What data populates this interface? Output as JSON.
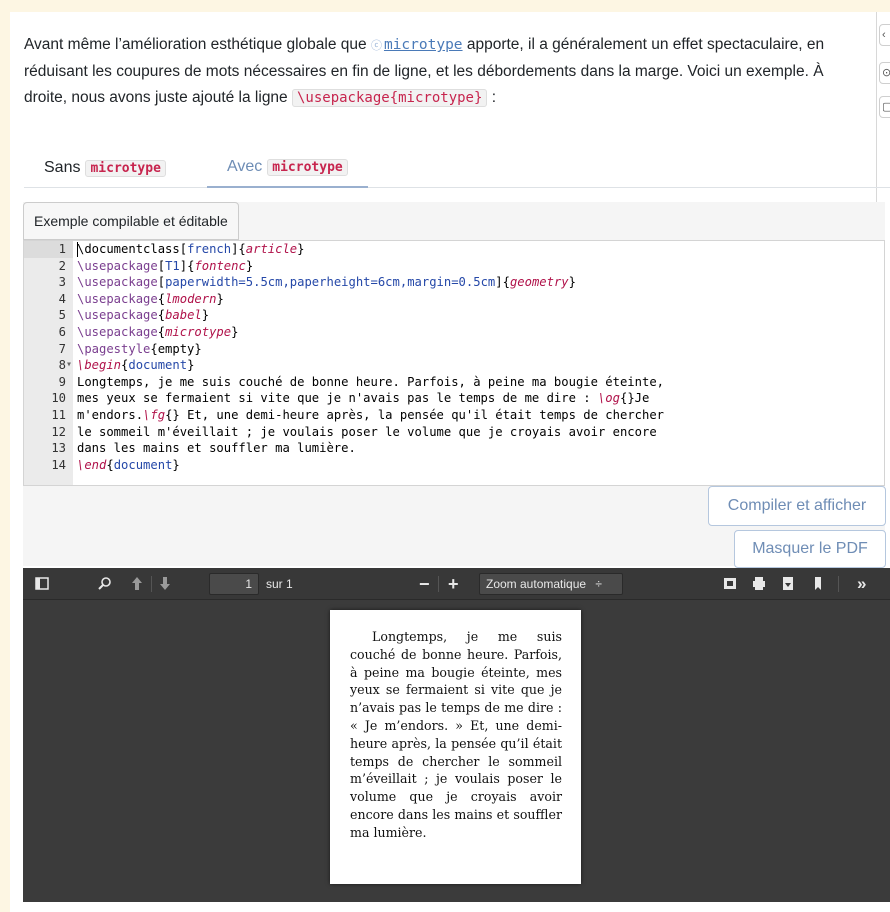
{
  "intro": {
    "part1": "Avant même l’amélioration esthétique globale que ",
    "ctan_mark": "ⓒ",
    "package_link": "microtype",
    "part2": " apporte, il a généralement un effet spectaculaire, en réduisant les coupures de mots nécessaires en fin de ligne, et les débordements dans la marge. Voici un exemple. À droite, nous avons juste ajouté la ligne ",
    "code": "\\usepackage{microtype}",
    "part3": " :"
  },
  "tabs": [
    {
      "label": "Sans",
      "code": "microtype",
      "active": false
    },
    {
      "label": "Avec",
      "code": "microtype",
      "active": true
    }
  ],
  "example_label": "Exemple compilable et éditable",
  "code_lines": [
    {
      "n": "1",
      "fold": "",
      "html": "\\documentclass[<span class=\"arg\">french</span>]{<span class=\"it\">article</span>}"
    },
    {
      "n": "2",
      "fold": "",
      "html": "<span class=\"kw\">\\usepackage</span>[<span class=\"arg\">T1</span>]{<span class=\"it\">fontenc</span>}"
    },
    {
      "n": "3",
      "fold": "",
      "html": "<span class=\"kw\">\\usepackage</span>[<span class=\"arg\">paperwidth=5.5cm,paperheight=6cm,margin=0.5cm</span>]{<span class=\"it\">geometry</span>}"
    },
    {
      "n": "4",
      "fold": "",
      "html": "<span class=\"kw\">\\usepackage</span>{<span class=\"it\">lmodern</span>}"
    },
    {
      "n": "5",
      "fold": "",
      "html": "<span class=\"kw\">\\usepackage</span>{<span class=\"it\">babel</span>}"
    },
    {
      "n": "6",
      "fold": "",
      "html": "<span class=\"kw\">\\usepackage</span>{<span class=\"it\">microtype</span>}"
    },
    {
      "n": "7",
      "fold": "",
      "html": "<span class=\"kw\">\\pagestyle</span>{empty}"
    },
    {
      "n": "8",
      "fold": "▾",
      "html": "<span class=\"it\">\\begin</span>{<span class=\"arg\">document</span>}"
    },
    {
      "n": "9",
      "fold": "",
      "html": "Longtemps, je me suis couché de bonne heure. Parfois, à peine ma bougie éteinte,"
    },
    {
      "n": "10",
      "fold": "",
      "html": "mes yeux se fermaient si vite que je n'avais pas le temps de me dire : <span class=\"it\">\\og</span>{}Je"
    },
    {
      "n": "11",
      "fold": "",
      "html": "m'endors.<span class=\"it\">\\fg</span>{} Et, une demi-heure après, la pensée qu'il était temps de chercher"
    },
    {
      "n": "12",
      "fold": "",
      "html": "le sommeil m'éveillait ; je voulais poser le volume que je croyais avoir encore"
    },
    {
      "n": "13",
      "fold": "",
      "html": "dans les mains et souffler ma lumière."
    },
    {
      "n": "14",
      "fold": "",
      "html": "<span class=\"it\">\\end</span>{<span class=\"arg\">document</span>}"
    }
  ],
  "buttons": {
    "compile": "Compiler et afficher",
    "hide_pdf": "Masquer le PDF"
  },
  "viewer": {
    "page_number": "1",
    "page_total": "sur 1",
    "zoom": "Zoom automatique",
    "zoom_arrow": "÷",
    "minus": "−",
    "plus": "+",
    "more": "»"
  },
  "pdf_text": "Longtemps, je me suis couché de bonne heure. Parfois, à peine ma bougie éteinte, mes yeux se fermaient si vite que je n’avais pas le temps de me dire : « Je m’endors. » Et, une demi-heure après, la pensée qu’il était temps de chercher le sommeil m’éveillait ; je voulais poser le volume que je croyais avoir encore dans les mains et souffler ma lumière.",
  "colors": {
    "page_bg": "#fdf6e3",
    "accent": "#6f8db5",
    "code_red": "#c7254e",
    "viewer_bg": "#3b3b3b"
  }
}
